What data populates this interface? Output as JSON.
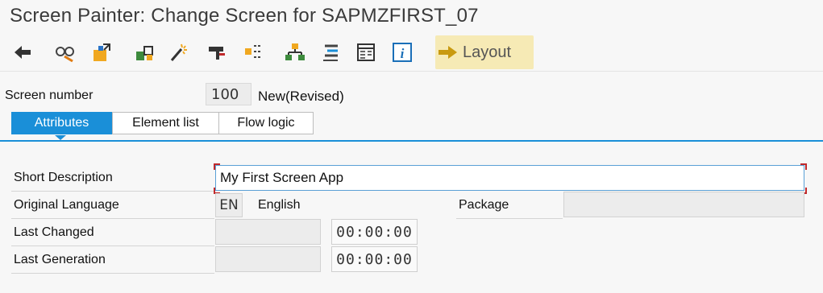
{
  "window": {
    "title": "Screen Painter: Change Screen for SAPMZFIRST_07"
  },
  "toolbar": {
    "icons": [
      "back-icon",
      "display-change-icon",
      "activate-icon",
      "check-icon",
      "generate-icon",
      "where-used-icon",
      "move-icon",
      "hierarchy-icon",
      "list-icon",
      "form-icon",
      "info-icon"
    ],
    "layout_label": "Layout"
  },
  "screen": {
    "number_label": "Screen number",
    "number": "100",
    "status": "New(Revised)"
  },
  "tabs": [
    {
      "label": "Attributes",
      "active": true
    },
    {
      "label": "Element list",
      "active": false
    },
    {
      "label": "Flow logic",
      "active": false
    }
  ],
  "attributes": {
    "short_description_label": "Short Description",
    "short_description": "My First Screen App",
    "original_language_label": "Original Language",
    "language_code": "EN",
    "language_name": "English",
    "package_label": "Package",
    "package": "",
    "last_changed_label": "Last Changed",
    "last_changed_date": "",
    "last_changed_time": "00:00:00",
    "last_generation_label": "Last Generation",
    "last_generation_date": "",
    "last_generation_time": "00:00:00"
  },
  "colors": {
    "accent": "#1a8fd8",
    "layout_button": "#f6eab5"
  }
}
